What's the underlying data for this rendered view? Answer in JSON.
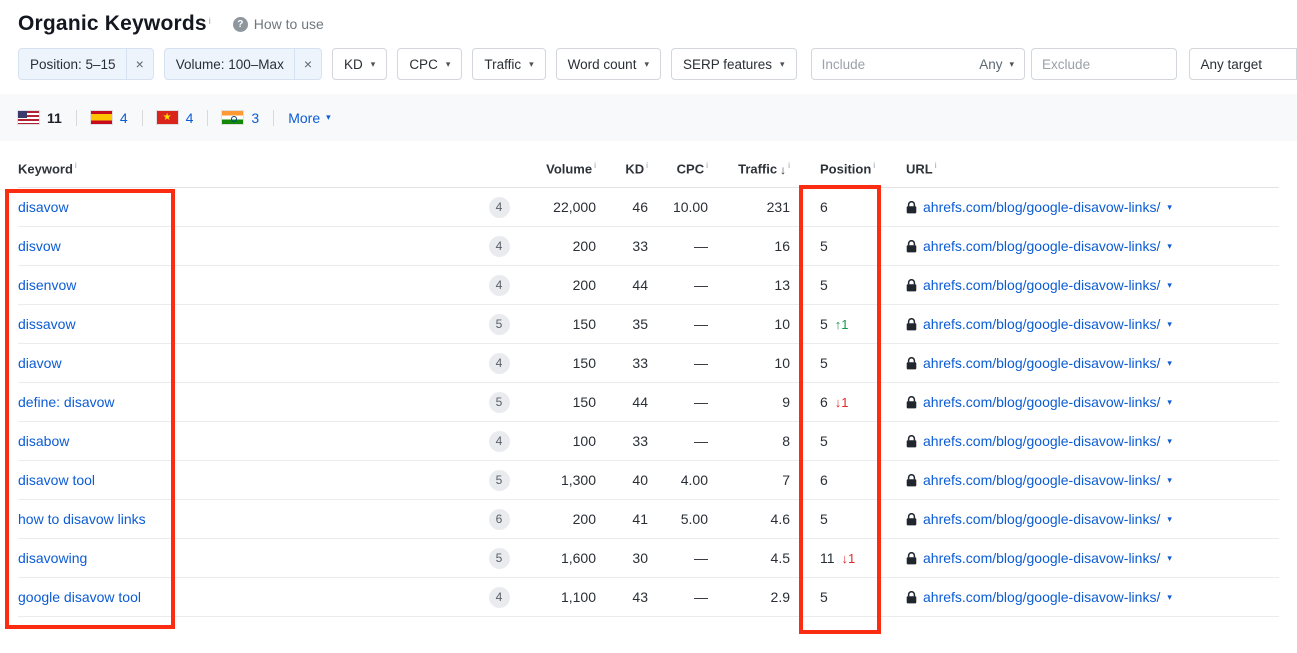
{
  "icons": {
    "info": "i",
    "help": "?",
    "caret": "▾",
    "close": "×",
    "sort_desc": "↓",
    "arrow_up": "↑",
    "arrow_down": "↓"
  },
  "header": {
    "title": "Organic Keywords",
    "how_to_use": "How to use"
  },
  "filters": {
    "pills": [
      {
        "label": "Position: 5–15"
      },
      {
        "label": "Volume: 100–Max"
      }
    ],
    "dropdowns": [
      {
        "label": "KD"
      },
      {
        "label": "CPC"
      },
      {
        "label": "Traffic"
      },
      {
        "label": "Word count"
      },
      {
        "label": "SERP features"
      }
    ],
    "include": {
      "placeholder": "Include",
      "mode": "Any"
    },
    "exclude": {
      "placeholder": "Exclude"
    },
    "target": {
      "label": "Any target"
    }
  },
  "countries": {
    "tabs": [
      {
        "flag": "us",
        "count": "11"
      },
      {
        "flag": "es",
        "count": "4"
      },
      {
        "flag": "vn",
        "count": "4"
      },
      {
        "flag": "in",
        "count": "3"
      }
    ],
    "more_label": "More"
  },
  "table": {
    "columns": {
      "keyword": "Keyword",
      "volume": "Volume",
      "kd": "KD",
      "cpc": "CPC",
      "traffic": "Traffic",
      "position": "Position",
      "url": "URL"
    },
    "rows": [
      {
        "keyword": "disavow",
        "badge": "4",
        "volume": "22,000",
        "kd": "46",
        "cpc": "10.00",
        "traffic": "231",
        "position": "6",
        "change_dir": "",
        "change": "",
        "url": "ahrefs.com/blog/google-disavow-links/"
      },
      {
        "keyword": "disvow",
        "badge": "4",
        "volume": "200",
        "kd": "33",
        "cpc": "—",
        "traffic": "16",
        "position": "5",
        "change_dir": "",
        "change": "",
        "url": "ahrefs.com/blog/google-disavow-links/"
      },
      {
        "keyword": "disenvow",
        "badge": "4",
        "volume": "200",
        "kd": "44",
        "cpc": "—",
        "traffic": "13",
        "position": "5",
        "change_dir": "",
        "change": "",
        "url": "ahrefs.com/blog/google-disavow-links/"
      },
      {
        "keyword": "dissavow",
        "badge": "5",
        "volume": "150",
        "kd": "35",
        "cpc": "—",
        "traffic": "10",
        "position": "5",
        "change_dir": "up",
        "change": "1",
        "url": "ahrefs.com/blog/google-disavow-links/"
      },
      {
        "keyword": "diavow",
        "badge": "4",
        "volume": "150",
        "kd": "33",
        "cpc": "—",
        "traffic": "10",
        "position": "5",
        "change_dir": "",
        "change": "",
        "url": "ahrefs.com/blog/google-disavow-links/"
      },
      {
        "keyword": "define: disavow",
        "badge": "5",
        "volume": "150",
        "kd": "44",
        "cpc": "—",
        "traffic": "9",
        "position": "6",
        "change_dir": "down",
        "change": "1",
        "url": "ahrefs.com/blog/google-disavow-links/"
      },
      {
        "keyword": "disabow",
        "badge": "4",
        "volume": "100",
        "kd": "33",
        "cpc": "—",
        "traffic": "8",
        "position": "5",
        "change_dir": "",
        "change": "",
        "url": "ahrefs.com/blog/google-disavow-links/"
      },
      {
        "keyword": "disavow tool",
        "badge": "5",
        "volume": "1,300",
        "kd": "40",
        "cpc": "4.00",
        "traffic": "7",
        "position": "6",
        "change_dir": "",
        "change": "",
        "url": "ahrefs.com/blog/google-disavow-links/"
      },
      {
        "keyword": "how to disavow links",
        "badge": "6",
        "volume": "200",
        "kd": "41",
        "cpc": "5.00",
        "traffic": "4.6",
        "position": "5",
        "change_dir": "",
        "change": "",
        "url": "ahrefs.com/blog/google-disavow-links/"
      },
      {
        "keyword": "disavowing",
        "badge": "5",
        "volume": "1,600",
        "kd": "30",
        "cpc": "—",
        "traffic": "4.5",
        "position": "11",
        "change_dir": "down",
        "change": "1",
        "url": "ahrefs.com/blog/google-disavow-links/"
      },
      {
        "keyword": "google disavow tool",
        "badge": "4",
        "volume": "1,100",
        "kd": "43",
        "cpc": "—",
        "traffic": "2.9",
        "position": "5",
        "change_dir": "",
        "change": "",
        "url": "ahrefs.com/blog/google-disavow-links/"
      }
    ]
  }
}
